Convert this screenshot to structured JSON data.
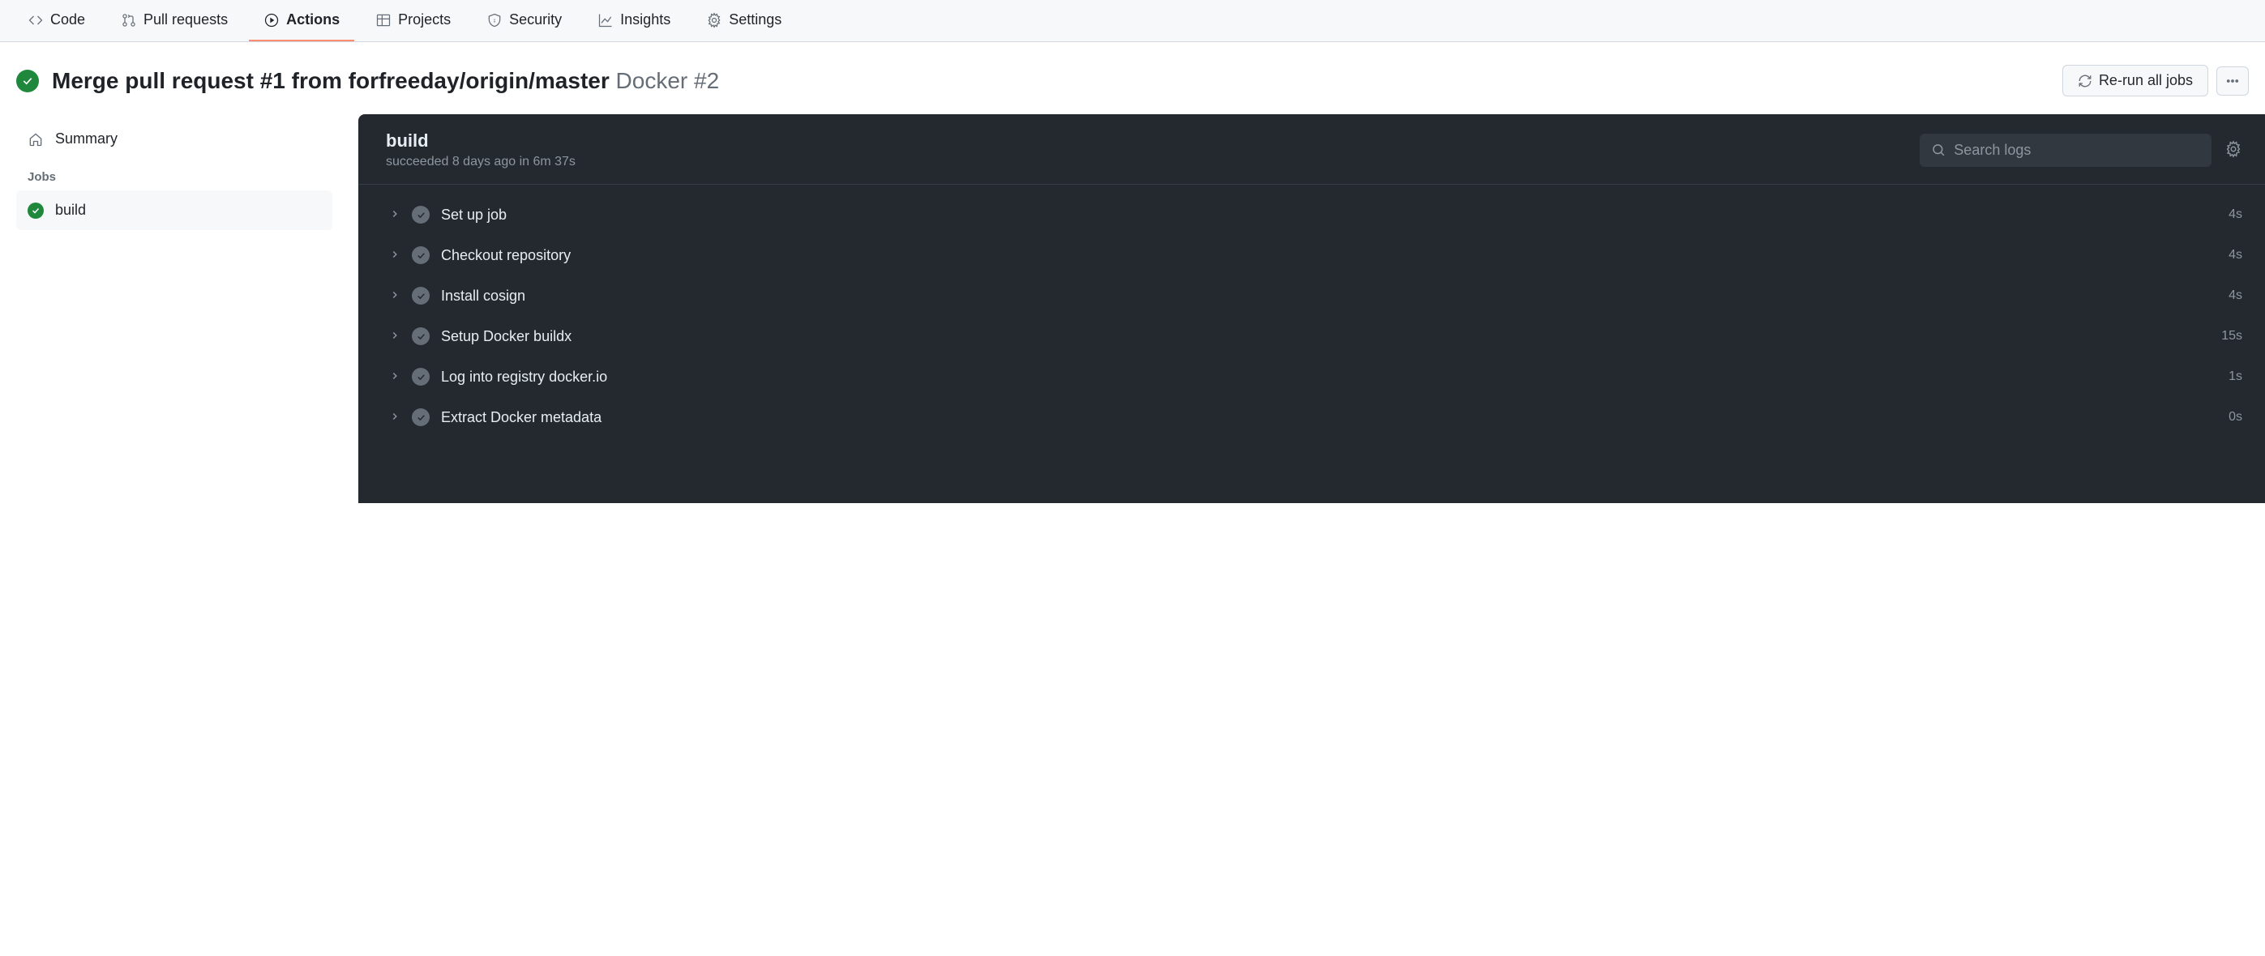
{
  "tabs": [
    {
      "label": "Code"
    },
    {
      "label": "Pull requests"
    },
    {
      "label": "Actions"
    },
    {
      "label": "Projects"
    },
    {
      "label": "Security"
    },
    {
      "label": "Insights"
    },
    {
      "label": "Settings"
    }
  ],
  "header": {
    "title": "Merge pull request #1 from forfreeday/origin/master",
    "workflow": "Docker #2",
    "rerun_label": "Re-run all jobs"
  },
  "sidebar": {
    "summary_label": "Summary",
    "jobs_label": "Jobs",
    "jobs": [
      {
        "name": "build"
      }
    ]
  },
  "log": {
    "title": "build",
    "subtitle": "succeeded 8 days ago in 6m 37s",
    "search_placeholder": "Search logs",
    "steps": [
      {
        "name": "Set up job",
        "duration": "4s"
      },
      {
        "name": "Checkout repository",
        "duration": "4s"
      },
      {
        "name": "Install cosign",
        "duration": "4s"
      },
      {
        "name": "Setup Docker buildx",
        "duration": "15s"
      },
      {
        "name": "Log into registry docker.io",
        "duration": "1s"
      },
      {
        "name": "Extract Docker metadata",
        "duration": "0s"
      }
    ]
  }
}
